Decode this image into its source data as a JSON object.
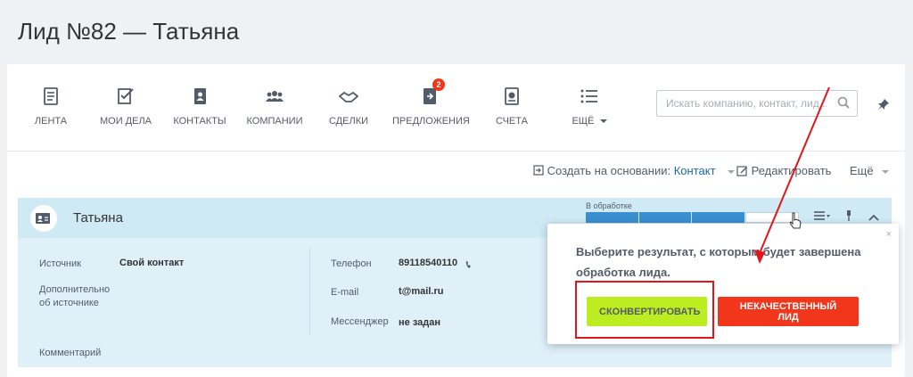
{
  "page": {
    "title": "Лид №82 — Татьяна"
  },
  "menu": {
    "items": [
      {
        "label": "Лента",
        "icon": "feed-icon"
      },
      {
        "label": "Мои дела",
        "icon": "tasks-icon"
      },
      {
        "label": "Контакты",
        "icon": "contacts-icon"
      },
      {
        "label": "Компании",
        "icon": "companies-icon"
      },
      {
        "label": "Сделки",
        "icon": "deals-icon"
      },
      {
        "label": "Предложения",
        "icon": "quotes-icon",
        "badge": "2"
      },
      {
        "label": "Счета",
        "icon": "invoices-icon"
      },
      {
        "label": "Ещё",
        "icon": "list-icon"
      }
    ]
  },
  "search": {
    "placeholder": "Искать компанию, контакт, лид..."
  },
  "actions": {
    "create_prefix": "Создать на основании:",
    "create_link": "Контакт",
    "edit": "Редактировать",
    "more": "Ещё"
  },
  "lead": {
    "name": "Татьяна",
    "status_label": "В обработке",
    "status_fill_fraction": 0.75
  },
  "details": {
    "source_label": "Источник",
    "source_value": "Свой контакт",
    "source_extra_label_1": "Дополнительно",
    "source_extra_label_2": "об источнике",
    "comment_label": "Комментарий",
    "phone_label": "Телефон",
    "phone_value": "89118540110",
    "email_label": "E-mail",
    "email_value": "t@mail.ru",
    "messenger_label": "Мессенджер",
    "messenger_value": "не задан"
  },
  "popup": {
    "text": "Выберите результат, с которым будет завершена обработка лида.",
    "convert_button": "Сконвертировать",
    "bad_lead_button": "Некачественный лид",
    "close": "×"
  },
  "colors": {
    "accent_blue": "#2067b0",
    "convert_green": "#bbed21",
    "bad_red": "#f1361b",
    "highlight_red": "#e0171a"
  }
}
